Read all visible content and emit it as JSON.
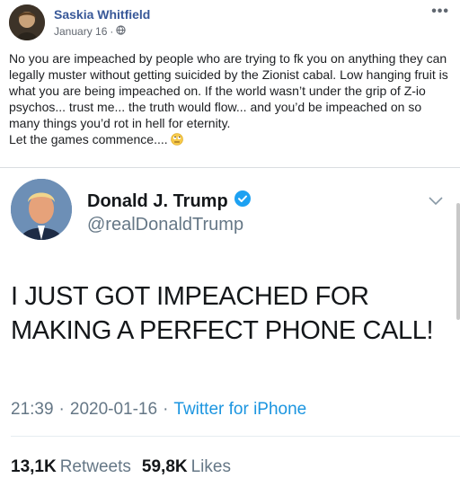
{
  "post": {
    "author": "Saskia Whitfield",
    "date": "January 16",
    "dot": "·",
    "body": "No you are impeached by people who are trying to fk you on anything they can legally muster without getting suicided by the Zionist cabal. Low hanging fruit is what you are being impeached on. If the world wasn’t under the grip of Z-io psychos... trust me... the truth would flow... and you’d be impeached on so many things you’d rot in hell for eternity.\nLet the games commence....",
    "more": "•••",
    "privacy_icon": "globe-icon",
    "emoji_icon": "rolling-eyes-emoji",
    "accent_color": "#385898"
  },
  "tweet": {
    "name": "Donald J. Trump",
    "handle": "@realDonaldTrump",
    "verified_icon": "verified-badge-icon",
    "text": "I JUST GOT IMPEACHED FOR\nMAKING A PERFECT PHONE CALL!",
    "time": "21:39",
    "date": "2020-01-16",
    "dot": "·",
    "source": "Twitter for iPhone",
    "retweets_count": "13,1K",
    "retweets_label": "Retweets",
    "likes_count": "59,8K",
    "likes_label": "Likes",
    "link_color": "#1b95e0"
  }
}
